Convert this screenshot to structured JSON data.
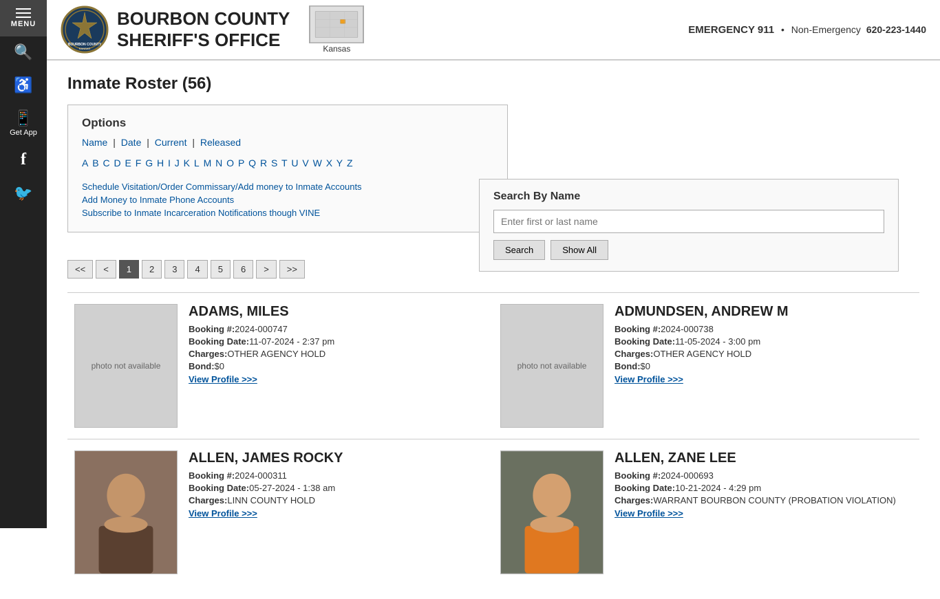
{
  "sidebar": {
    "menu_label": "MENU",
    "search_icon": "🔍",
    "accessibility_icon": "♿",
    "app_label": "Get App",
    "facebook_icon": "f",
    "twitter_icon": "🐦"
  },
  "header": {
    "title_line1": "BOURBON COUNTY",
    "title_line2": "SHERIFF'S OFFICE",
    "map_label": "Kansas",
    "emergency_label": "EMERGENCY 911",
    "separator": "•",
    "non_emergency_label": "Non-Emergency",
    "non_emergency_number": "620-223-1440"
  },
  "page": {
    "title": "Inmate Roster (56)"
  },
  "options": {
    "heading": "Options",
    "links": [
      {
        "label": "Name",
        "href": "#"
      },
      {
        "label": "Date",
        "href": "#"
      },
      {
        "label": "Current",
        "href": "#"
      },
      {
        "label": "Released",
        "href": "#"
      }
    ],
    "alphabet": [
      "A",
      "B",
      "C",
      "D",
      "E",
      "F",
      "G",
      "H",
      "I",
      "J",
      "K",
      "L",
      "M",
      "N",
      "O",
      "P",
      "Q",
      "R",
      "S",
      "T",
      "U",
      "V",
      "W",
      "X",
      "Y",
      "Z"
    ],
    "extra_links": [
      "Schedule Visitation/Order Commissary/Add money to Inmate Accounts",
      "Add Money to Inmate Phone Accounts",
      "Subscribe to Inmate Incarceration Notifications though VINE"
    ]
  },
  "search": {
    "title": "Search By Name",
    "placeholder": "Enter first or last name",
    "search_btn": "Search",
    "show_all_btn": "Show All"
  },
  "pagination": {
    "buttons": [
      "<<",
      "<",
      "1",
      "2",
      "3",
      "4",
      "5",
      "6",
      ">",
      ">>"
    ],
    "active": "1"
  },
  "inmates": [
    {
      "name": "ADAMS, MILES",
      "booking_num": "2024-000747",
      "booking_date": "11-07-2024 - 2:37 pm",
      "charges": "OTHER AGENCY HOLD",
      "bond": "$0",
      "profile_link": "View Profile >>>",
      "has_photo": false
    },
    {
      "name": "ADMUNDSEN, ANDREW M",
      "booking_num": "2024-000738",
      "booking_date": "11-05-2024 - 3:00 pm",
      "charges": "OTHER AGENCY HOLD",
      "bond": "$0",
      "profile_link": "View Profile >>>",
      "has_photo": false
    },
    {
      "name": "ALLEN, JAMES ROCKY",
      "booking_num": "2024-000311",
      "booking_date": "05-27-2024 - 1:38 am",
      "charges": "LINN COUNTY HOLD",
      "bond": "",
      "profile_link": "View Profile >>>",
      "has_photo": true
    },
    {
      "name": "ALLEN, ZANE LEE",
      "booking_num": "2024-000693",
      "booking_date": "10-21-2024 - 4:29 pm",
      "charges": "WARRANT BOURBON COUNTY (PROBATION VIOLATION)",
      "bond": "",
      "profile_link": "View Profile >>>",
      "has_photo": true
    }
  ],
  "photo_unavailable": "photo not available"
}
